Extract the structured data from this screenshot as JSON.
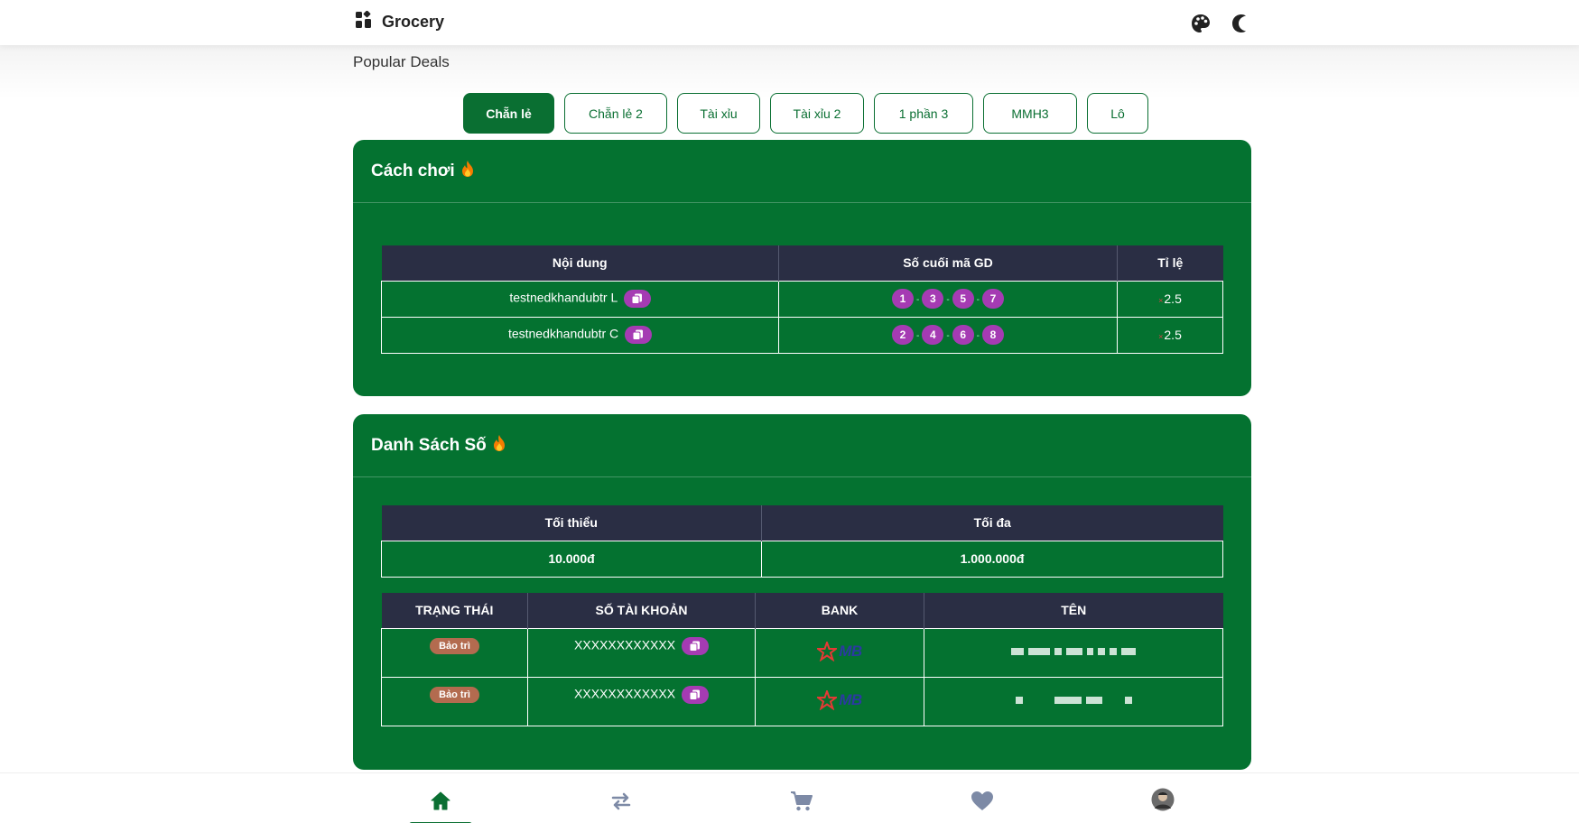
{
  "header": {
    "brand": "Grocery",
    "icons": [
      "palette-icon",
      "moon-icon"
    ]
  },
  "section_title": "Popular Deals",
  "tabs": [
    {
      "label": "Chẵn lẻ",
      "active": true
    },
    {
      "label": "Chẵn lẻ 2",
      "active": false
    },
    {
      "label": "Tài xỉu",
      "active": false
    },
    {
      "label": "Tài xỉu 2",
      "active": false
    },
    {
      "label": "1 phần 3",
      "active": false
    },
    {
      "label": "MMH3",
      "active": false
    },
    {
      "label": "Lô",
      "active": false
    }
  ],
  "how_to_play": {
    "title": "Cách chơi",
    "columns": [
      "Nội dung",
      "Số cuối mã GD",
      "Tỉ lệ"
    ],
    "rows": [
      {
        "content": "testnedkhandubtr L",
        "numbers": [
          "1",
          "3",
          "5",
          "7"
        ],
        "rate": "2.5"
      },
      {
        "content": "testnedkhandubtr C",
        "numbers": [
          "2",
          "4",
          "6",
          "8"
        ],
        "rate": "2.5"
      }
    ]
  },
  "number_list": {
    "title": "Danh Sách Số",
    "limits_columns": [
      "Tối thiểu",
      "Tối đa"
    ],
    "limits": {
      "min": "10.000đ",
      "max": "1.000.000đ"
    },
    "account_columns": [
      "TRẠNG THÁI",
      "SỐ TÀI KHOẢN",
      "BANK",
      "TÊN"
    ],
    "accounts": [
      {
        "status": "Bảo trì",
        "account_number": "XXXXXXXXXXXX",
        "bank": "MB"
      },
      {
        "status": "Bảo trì",
        "account_number": "XXXXXXXXXXXX",
        "bank": "MB"
      }
    ]
  },
  "bottom_nav": [
    "home-icon",
    "transfer-icon",
    "cart-icon",
    "heart-icon",
    "avatar"
  ],
  "colors": {
    "primary": "#047230",
    "table_header": "#2a2e44",
    "badge": "#a53bb3",
    "status": "#b36b4f"
  }
}
